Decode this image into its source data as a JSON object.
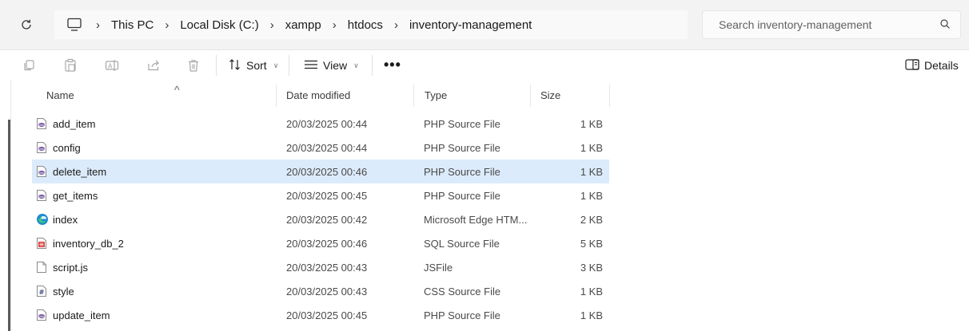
{
  "address_bar": {
    "breadcrumbs": [
      "This PC",
      "Local Disk (C:)",
      "xampp",
      "htdocs",
      "inventory-management"
    ],
    "search_placeholder": "Search inventory-management"
  },
  "command_bar": {
    "sort_label": "Sort",
    "view_label": "View",
    "more_label": "•••",
    "details_label": "Details"
  },
  "columns": {
    "name": "Name",
    "date": "Date modified",
    "type": "Type",
    "size": "Size"
  },
  "files": [
    {
      "name": "add_item",
      "date": "20/03/2025 00:44",
      "type": "PHP Source File",
      "size": "1 KB",
      "icon": "php-file-icon",
      "selected": false
    },
    {
      "name": "config",
      "date": "20/03/2025 00:44",
      "type": "PHP Source File",
      "size": "1 KB",
      "icon": "php-file-icon",
      "selected": false
    },
    {
      "name": "delete_item",
      "date": "20/03/2025 00:46",
      "type": "PHP Source File",
      "size": "1 KB",
      "icon": "php-file-icon",
      "selected": true
    },
    {
      "name": "get_items",
      "date": "20/03/2025 00:45",
      "type": "PHP Source File",
      "size": "1 KB",
      "icon": "php-file-icon",
      "selected": false
    },
    {
      "name": "index",
      "date": "20/03/2025 00:42",
      "type": "Microsoft Edge HTM...",
      "size": "2 KB",
      "icon": "edge-html-icon",
      "selected": false
    },
    {
      "name": "inventory_db_2",
      "date": "20/03/2025 00:46",
      "type": "SQL Source File",
      "size": "5 KB",
      "icon": "sql-file-icon",
      "selected": false
    },
    {
      "name": "script.js",
      "date": "20/03/2025 00:43",
      "type": "JSFile",
      "size": "3 KB",
      "icon": "blank-file-icon",
      "selected": false
    },
    {
      "name": "style",
      "date": "20/03/2025 00:43",
      "type": "CSS Source File",
      "size": "1 KB",
      "icon": "css-file-icon",
      "selected": false
    },
    {
      "name": "update_item",
      "date": "20/03/2025 00:45",
      "type": "PHP Source File",
      "size": "1 KB",
      "icon": "php-file-icon",
      "selected": false
    }
  ],
  "colors": {
    "selected_row": "#dcebfb",
    "php_icon": "#7a5aa8",
    "sql_icon": "#d93a3a",
    "edge_icon": "#1f8ad6"
  }
}
